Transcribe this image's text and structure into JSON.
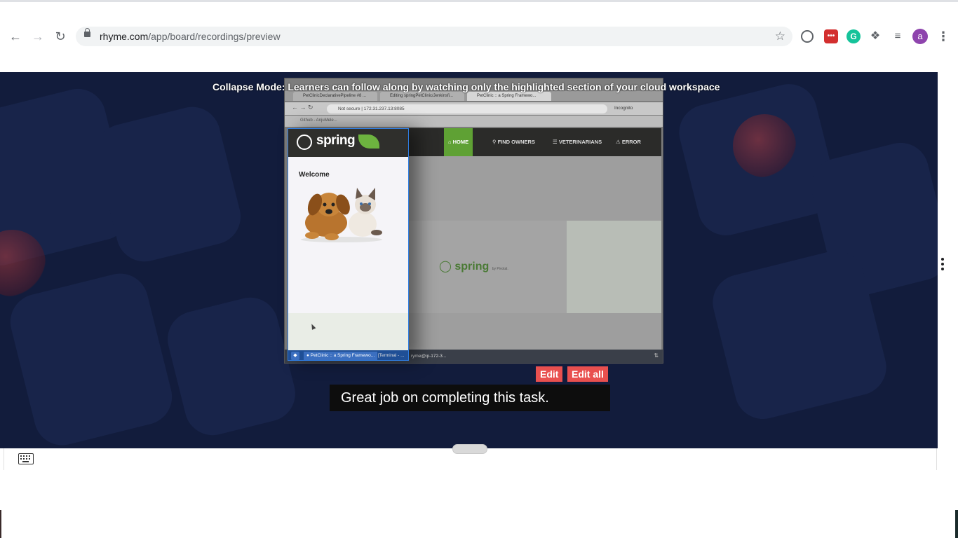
{
  "browser": {
    "url_domain": "rhyme.com",
    "url_path": "/app/board/recordings/preview",
    "avatar_letter": "a",
    "extensions": [
      "reader-icon",
      "lastpass-icon",
      "grammarly-icon",
      "puzzle-icon",
      "media-queue-icon"
    ]
  },
  "recording": {
    "collapse_note": "Collapse Mode: Learners can follow along by watching only the highlighted section of your cloud workspace",
    "inner_tabs": [
      "PetClinicDeclarativePipeline #8 ...",
      "Editing springPetClinic/Jenkinsfi...",
      "PetClinic :: a Spring Framewo..."
    ],
    "inner_address": "172.31.237.13:8085",
    "inner_security": "Not secure",
    "inner_incognito": "Incognito",
    "inner_bookmark": "Github - AnjuMele...",
    "inner_nav": {
      "home": "HOME",
      "find_owners": "FIND OWNERS",
      "veterinarians": "VETERINARIANS",
      "error": "ERROR"
    },
    "brand": "spring",
    "brand_by": "by Pivotal.",
    "welcome": "Welcome",
    "taskbar": {
      "task1": "PetClinic :: a Spring Framewo...",
      "task2": "[Terminal - ...",
      "task3": "ryme@ip-172-3..."
    }
  },
  "actions": {
    "edit": "Edit",
    "edit_all": "Edit all"
  },
  "caption": "Great job on completing this task.",
  "colors": {
    "page_bg": "#121c3c",
    "edit_button": "#e9504f",
    "spring_green": "#6db33f",
    "focus_border": "#2f7de1"
  }
}
